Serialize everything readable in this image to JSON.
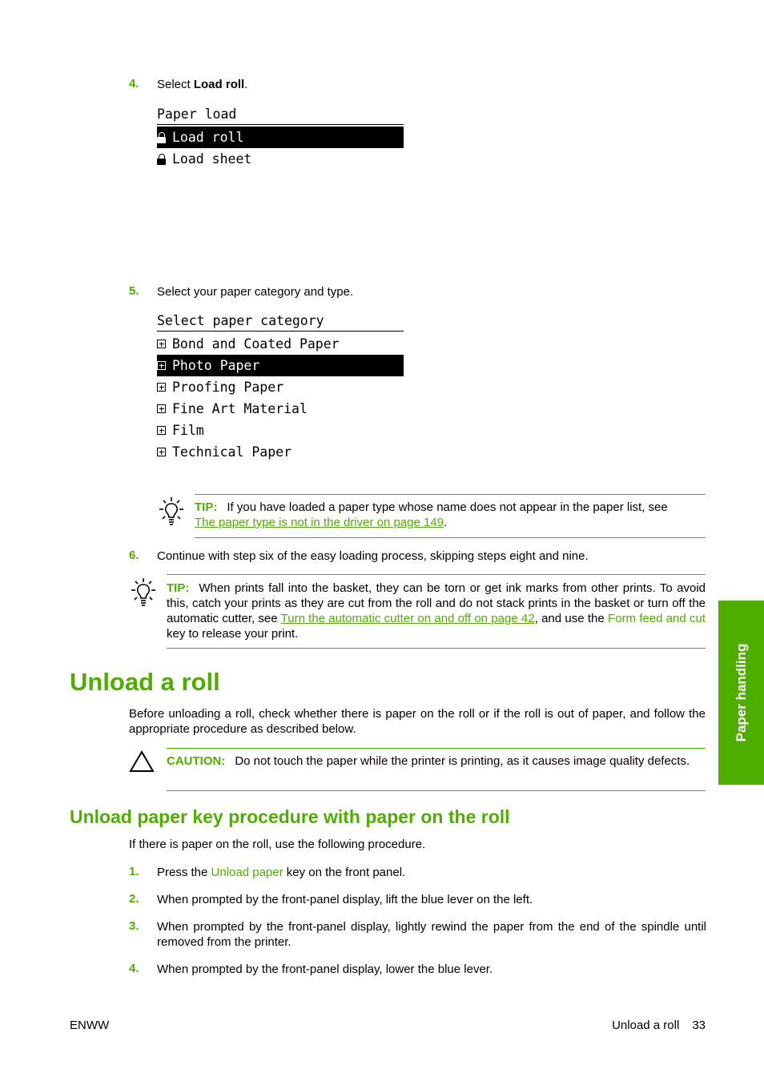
{
  "step4": {
    "number": "4.",
    "text_prefix": "Select ",
    "text_bold": "Load roll",
    "text_suffix": ".",
    "display": {
      "title": "Paper load",
      "items": [
        {
          "icon": "lock-icon",
          "label": "Load roll",
          "selected": true
        },
        {
          "icon": "lock-icon",
          "label": "Load sheet",
          "selected": false
        }
      ]
    }
  },
  "step5": {
    "number": "5.",
    "text": "Select your paper category and type.",
    "display": {
      "title": "Select paper category",
      "items": [
        {
          "icon": "expand-icon",
          "label": "Bond and Coated Paper",
          "selected": false
        },
        {
          "icon": "expand-icon",
          "label": "Photo Paper",
          "selected": true
        },
        {
          "icon": "expand-icon",
          "label": "Proofing Paper",
          "selected": false
        },
        {
          "icon": "expand-icon",
          "label": "Fine Art Material",
          "selected": false
        },
        {
          "icon": "expand-icon",
          "label": "Film",
          "selected": false
        },
        {
          "icon": "expand-icon",
          "label": "Technical Paper",
          "selected": false
        }
      ]
    },
    "tip": {
      "label": "TIP:",
      "text": "If you have loaded a paper type whose name does not appear in the paper list, see ",
      "link": "The paper type is not in the driver on page 149",
      "suffix": "."
    }
  },
  "step6": {
    "number": "6.",
    "text": "Continue with step six of the easy loading process, skipping steps eight and nine."
  },
  "tip2": {
    "label": "TIP:",
    "text1": "When prints fall into the basket, they can be torn or get ink marks from other prints. To avoid this, catch your prints as they are cut from the roll and do not stack prints in the basket or turn off the automatic cutter, see ",
    "link": "Turn the automatic cutter on and off on page 42",
    "text2": ", and use the ",
    "key": "Form feed and cut",
    "text3": " key to release your print."
  },
  "section": {
    "title": "Unload a roll",
    "intro": "Before unloading a roll, check whether there is paper on the roll or if the roll is out of paper, and follow the appropriate procedure as described below.",
    "caution": {
      "label": "CAUTION:",
      "text": "Do not touch the paper while the printer is printing, as it causes image quality defects."
    }
  },
  "subsection": {
    "title": "Unload paper key procedure with paper on the roll",
    "intro": "If there is paper on the roll, use the following procedure.",
    "steps": [
      {
        "number": "1.",
        "prefix": "Press the ",
        "key": "Unload paper",
        "suffix": " key on the front panel."
      },
      {
        "number": "2.",
        "text": "When prompted by the front-panel display, lift the blue lever on the left."
      },
      {
        "number": "3.",
        "text": "When prompted by the front-panel display, lightly rewind the paper from the end of the spindle until removed from the printer."
      },
      {
        "number": "4.",
        "text": "When prompted by the front-panel display, lower the blue lever."
      }
    ]
  },
  "side_tab": {
    "label": "Paper handling",
    "color": "#4fad00"
  },
  "footer": {
    "left": "ENWW",
    "right_title": "Unload a roll",
    "page": "33"
  },
  "colors": {
    "accent": "#4fad00"
  }
}
